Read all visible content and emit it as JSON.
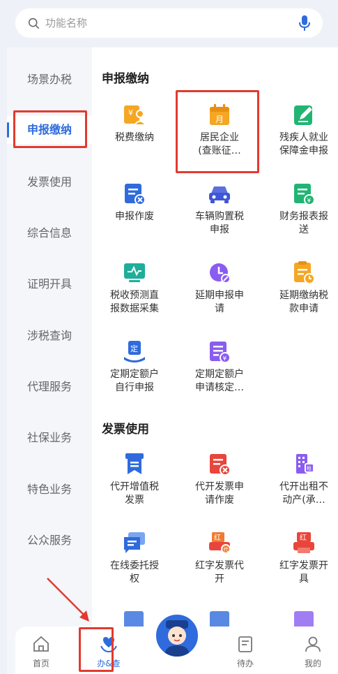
{
  "search": {
    "placeholder": "功能名称"
  },
  "sidebar": {
    "items": [
      "场景办税",
      "申报缴纳",
      "发票使用",
      "综合信息",
      "证明开具",
      "涉税查询",
      "代理服务",
      "社保业务",
      "特色业务",
      "公众服务"
    ],
    "active_index": 1
  },
  "sections": [
    {
      "title": "申报缴纳",
      "items": [
        {
          "label": "税费缴纳",
          "icon": "tax-payment-icon"
        },
        {
          "label": "居民企业\n(查账征…",
          "icon": "calendar-month-icon"
        },
        {
          "label": "残疾人就业\n保障金申报",
          "icon": "edit-document-icon"
        },
        {
          "label": "申报作废",
          "icon": "cancel-declaration-icon"
        },
        {
          "label": "车辆购置税\n申报",
          "icon": "car-icon"
        },
        {
          "label": "财务报表报\n送",
          "icon": "financial-report-icon"
        },
        {
          "label": "税收预测直\n报数据采集",
          "icon": "monitor-chart-icon"
        },
        {
          "label": "延期申报申\n请",
          "icon": "clock-edit-icon"
        },
        {
          "label": "延期缴纳税\n款申请",
          "icon": "document-clock-icon"
        },
        {
          "label": "定期定额户\n自行申报",
          "icon": "fixed-quota-icon"
        },
        {
          "label": "定期定额户\n申请核定…",
          "icon": "list-coin-icon"
        }
      ]
    },
    {
      "title": "发票使用",
      "items": [
        {
          "label": "代开增值税\n发票",
          "icon": "invoice-ribbon-icon"
        },
        {
          "label": "代开发票申\n请作废",
          "icon": "invoice-cancel-icon"
        },
        {
          "label": "代开出租不\n动产(承…",
          "icon": "building-rent-icon"
        },
        {
          "label": "在线委托授\n权",
          "icon": "chat-authorize-icon"
        },
        {
          "label": "红字发票代\n开",
          "icon": "red-invoice-proxy-icon"
        },
        {
          "label": "红字发票开\n具",
          "icon": "red-invoice-printer-icon"
        }
      ]
    }
  ],
  "tabbar": {
    "items": [
      {
        "label": "首页",
        "icon": "home-icon"
      },
      {
        "label": "办&查",
        "icon": "heart-hand-icon"
      },
      {
        "label": "待办",
        "icon": "todo-icon"
      },
      {
        "label": "我的",
        "icon": "user-icon"
      }
    ],
    "active_index": 1
  },
  "colors": {
    "accent": "#2f6bdc",
    "highlight": "#e23a2e",
    "orange": "#f5a623",
    "green": "#21b573",
    "purple": "#8a5cf0",
    "red": "#e8453c"
  }
}
